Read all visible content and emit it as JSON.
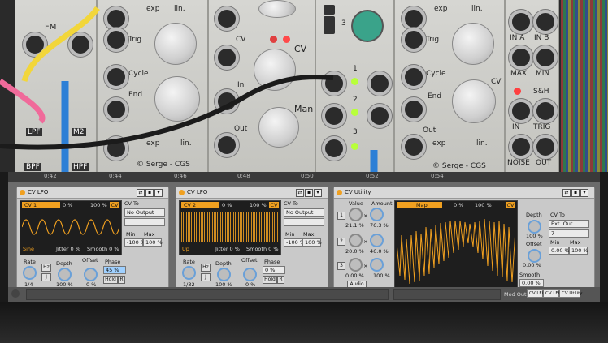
{
  "hardware": {
    "labels": {
      "fm": "FM",
      "exp_lin_1": "exp",
      "lin_1": "lin.",
      "trig_1": "Trig",
      "cycle": "Cycle",
      "end_1": "End",
      "lpf": "LPF",
      "m2": "M2",
      "bpf": "BPF",
      "hpf": "HPF",
      "exp_2": "exp",
      "lin_2": "lin.",
      "cv": "CV",
      "cv_big": "CV",
      "in": "In",
      "man": "Man",
      "out": "Out",
      "brand_1": "© Serge - CGS",
      "brand_2": "© Serge - CGS",
      "num_1": "1",
      "num_2": "2",
      "num_3": "3",
      "sw_3": "3",
      "exp_3": "exp",
      "lin_3": "lin.",
      "trig_2": "Trig",
      "cycle_2": "Cycle",
      "end_2": "End",
      "out_2": "Out",
      "cv_2": "CV",
      "exp_4": "exp",
      "lin_4": "lin.",
      "in_a": "IN A",
      "in_b": "IN B",
      "max": "MAX",
      "min": "MIN",
      "sh": "S&H",
      "in_sh": "IN",
      "trig_sh": "TRIG",
      "noise": "NOISE",
      "out_sh": "OUT"
    }
  },
  "ruler": {
    "ticks": [
      "0:42",
      "0:44",
      "0:46",
      "0:48",
      "0:50",
      "0:52",
      "0:54"
    ]
  },
  "devices": [
    {
      "title": "CV LFO",
      "scope_label": "CV 1",
      "depth_pct": "0 %",
      "amount_pct": "100 %",
      "cv_tag": "CV",
      "shape": "Sine",
      "jitter": "Jitter 0 %",
      "smooth": "Smooth 0 %",
      "cv_to_label": "CV To",
      "cv_to_value": "No Output",
      "min_label": "Min",
      "max_label": "Max",
      "min_value": "-100 %",
      "max_value": "100 %",
      "rate_label": "Rate",
      "rate_value": "1/4",
      "hz": "Hz",
      "sync": "J",
      "depth_label": "Depth",
      "depth_value": "100 %",
      "offset_label": "Offset",
      "offset_value": "0 %",
      "phase_label": "Phase",
      "phase_value": "45 %",
      "hold": "Hold",
      "r": "R"
    },
    {
      "title": "CV LFO",
      "scope_label": "CV 2",
      "depth_pct": "0 %",
      "amount_pct": "100 %",
      "cv_tag": "CV",
      "shape": "Up",
      "jitter": "Jitter 0 %",
      "smooth": "Smooth 0 %",
      "cv_to_label": "CV To",
      "cv_to_value": "No Output",
      "min_label": "Min",
      "max_label": "Max",
      "min_value": "-100 %",
      "max_value": "100 %",
      "rate_label": "Rate",
      "rate_value": "1/32",
      "hz": "Hz",
      "sync": "J",
      "depth_label": "Depth",
      "depth_value": "100 %",
      "offset_label": "Offset",
      "offset_value": "0 %",
      "phase_label": "Phase",
      "phase_value": "0 %",
      "hold": "Hold",
      "r": "R"
    }
  ],
  "utility": {
    "title": "CV Utility",
    "value_label": "Value",
    "amount_label": "Amount",
    "rows": [
      {
        "num": "1",
        "value": "21.1 %",
        "amount": "76.3 %"
      },
      {
        "num": "2",
        "value": "20.0 %",
        "amount": "46.0 %"
      },
      {
        "num": "3",
        "value": "0.00 %",
        "amount": "100 %"
      }
    ],
    "audio": "Audio",
    "scope_label": "Map",
    "scope_pct1": "0 %",
    "scope_pct2": "100 %",
    "cv_tag": "CV",
    "depth_label": "Depth",
    "depth_value": "100 %",
    "offset_label": "Offset",
    "offset_value": "0.00 %",
    "smooth_label": "Smooth",
    "smooth_value": "0.00 %",
    "cv_to_label": "CV To",
    "cv_to_value": "Ext. Out",
    "cv_to_channel": "7",
    "min_label": "Min",
    "max_label": "Max",
    "min_value": "0.00 %",
    "max_value": "100 %"
  },
  "footer": {
    "label": "Mod Out",
    "chains": [
      "CV LFO",
      "CV LFO",
      "CV Utility"
    ]
  },
  "colors": {
    "accent": "#f0a020",
    "scope_bg": "#1e1e1e",
    "knob_ring": "#6aa0d8"
  }
}
